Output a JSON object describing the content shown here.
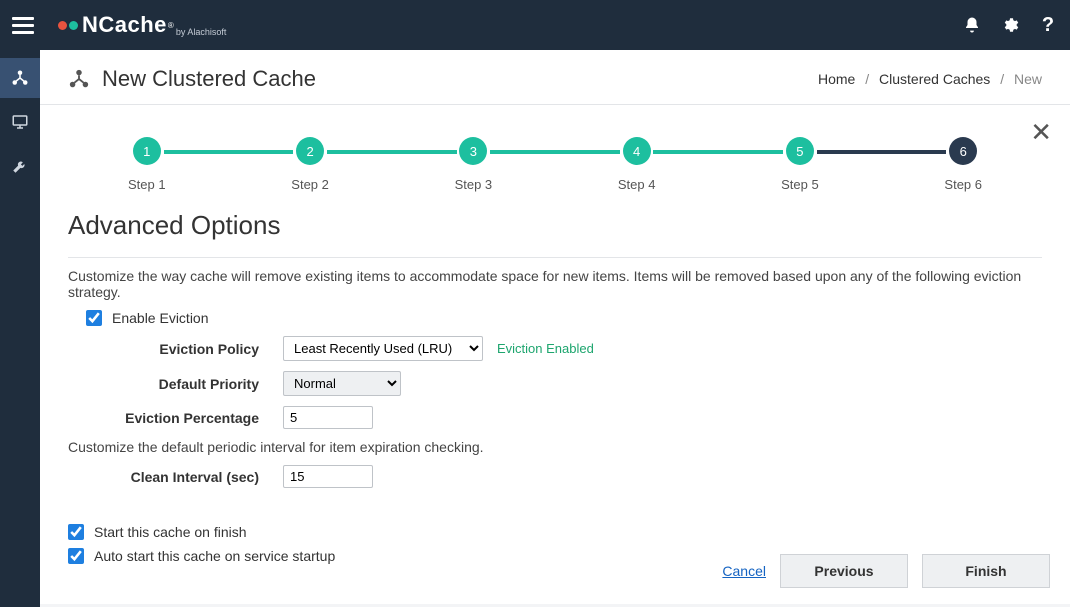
{
  "topbar": {
    "product_name": "NCache",
    "byline": "by Alachisoft"
  },
  "page": {
    "title": "New Clustered Cache"
  },
  "breadcrumb": {
    "home": "Home",
    "clustered_caches": "Clustered Caches",
    "current": "New"
  },
  "stepper": {
    "steps": [
      {
        "num": "1",
        "label": "Step 1"
      },
      {
        "num": "2",
        "label": "Step 2"
      },
      {
        "num": "3",
        "label": "Step 3"
      },
      {
        "num": "4",
        "label": "Step 4"
      },
      {
        "num": "5",
        "label": "Step 5"
      },
      {
        "num": "6",
        "label": "Step 6"
      }
    ]
  },
  "panel": {
    "title": "Advanced Options",
    "eviction_desc": "Customize the way cache will remove existing items to accommodate space for new items. Items will be removed based upon any of the following eviction strategy.",
    "enable_eviction_label": "Enable Eviction",
    "eviction_policy_label": "Eviction Policy",
    "eviction_policy_value": "Least Recently Used (LRU)",
    "eviction_status": "Eviction Enabled",
    "default_priority_label": "Default Priority",
    "default_priority_value": "Normal",
    "eviction_percentage_label": "Eviction Percentage",
    "eviction_percentage_value": "5",
    "clean_interval_desc": "Customize the default periodic interval for item expiration checking.",
    "clean_interval_label": "Clean Interval (sec)",
    "clean_interval_value": "15",
    "start_on_finish_label": "Start this cache on finish",
    "auto_start_label": "Auto start this cache on service startup"
  },
  "footer": {
    "cancel": "Cancel",
    "previous": "Previous",
    "finish": "Finish"
  }
}
